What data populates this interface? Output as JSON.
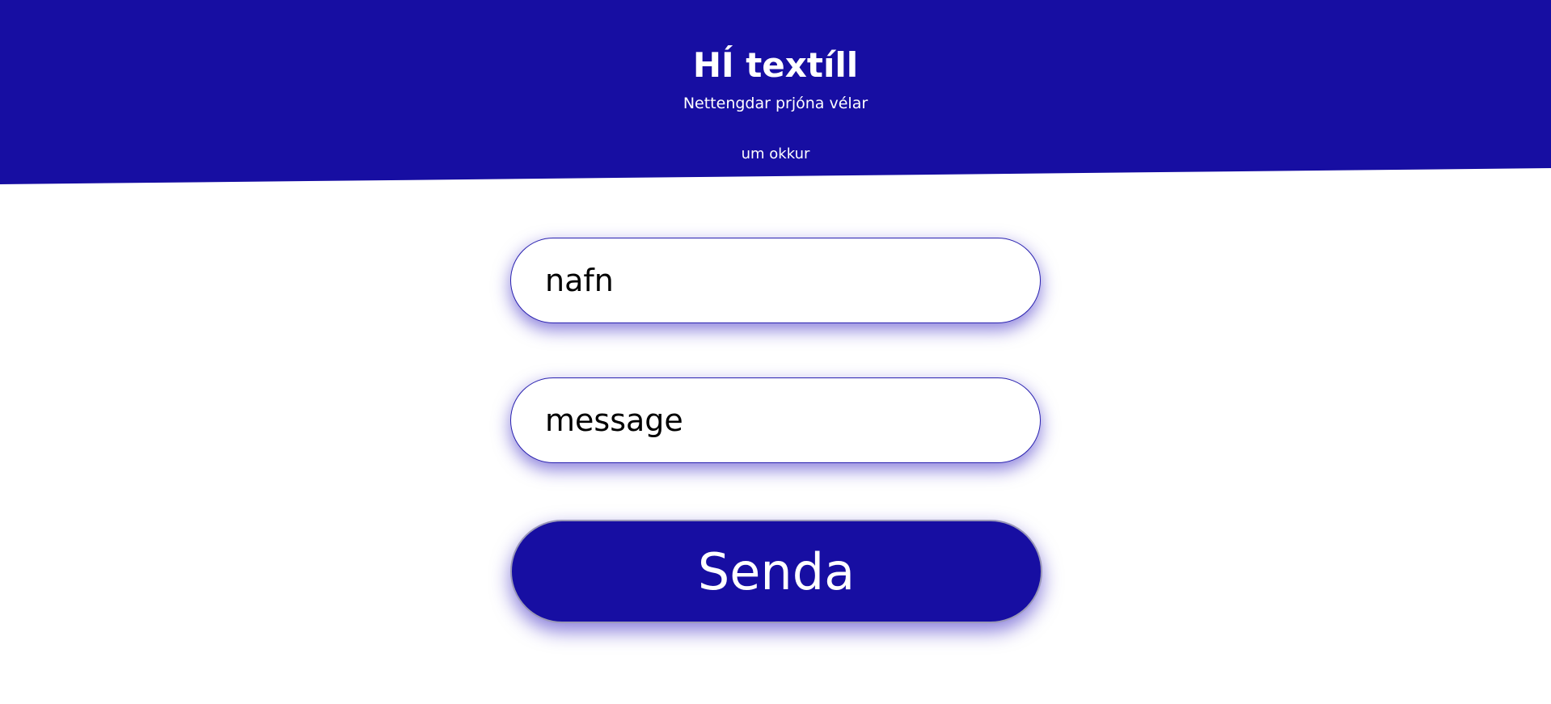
{
  "header": {
    "title": "HÍ textíll",
    "subtitle": "Nettengdar prjóna vélar",
    "nav": [
      {
        "label": "um okkur"
      }
    ]
  },
  "form": {
    "name_placeholder": "nafn",
    "message_placeholder": "message",
    "submit_label": "Senda"
  },
  "colors": {
    "brand": "#170ea2"
  }
}
